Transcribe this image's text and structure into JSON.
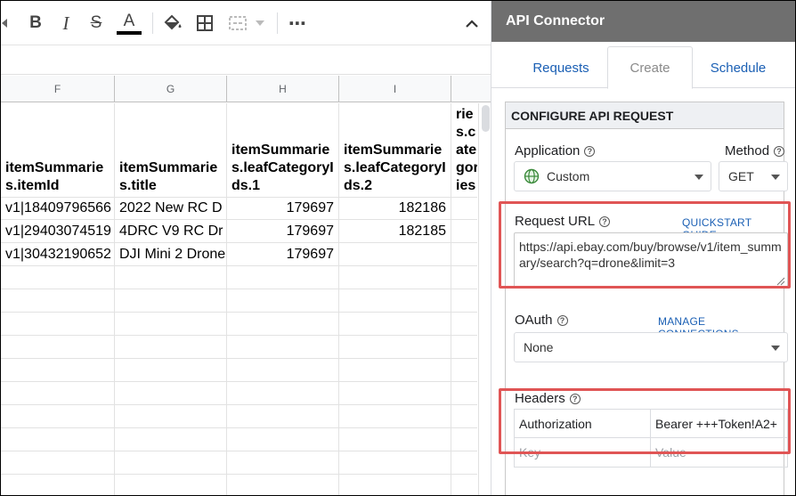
{
  "toolbar": {
    "bold": "B",
    "italic": "I",
    "strike": "S",
    "text_color": "A",
    "more": "⋯"
  },
  "sheet": {
    "columns": [
      "F",
      "G",
      "H",
      "I",
      ""
    ],
    "header_row": [
      "itemSummaries.itemId",
      "itemSummaries.title",
      "itemSummaries.leafCategoryIds.1",
      "itemSummaries.leafCategoryIds.2",
      "itemSummaries.categories"
    ],
    "rows": [
      [
        "v1|18409796566",
        "2022 New RC D",
        "179697",
        "182186",
        ""
      ],
      [
        "v1|29403074519",
        "4DRC V9 RC Dr",
        "179697",
        "182185",
        ""
      ],
      [
        "v1|30432190652",
        "DJI Mini 2 Drone",
        "179697",
        "",
        ""
      ]
    ]
  },
  "panel": {
    "title": "API Connector",
    "tabs": [
      "Requests",
      "Create",
      "Schedule"
    ],
    "active_tab": "Create",
    "section_title": "CONFIGURE API REQUEST",
    "application_label": "Application",
    "application_value": "Custom",
    "method_label": "Method",
    "method_value": "GET",
    "request_url_label": "Request URL",
    "quickstart_link": "QUICKSTART GUIDE",
    "request_url_value": "https://api.ebay.com/buy/browse/v1/item_summary/search?q=drone&limit=3",
    "oauth_label": "OAuth",
    "manage_connections_link": "MANAGE CONNECTIONS",
    "oauth_value": "None",
    "headers_label": "Headers",
    "headers": [
      {
        "key": "Authorization",
        "value": "Bearer +++Token!A2+"
      }
    ],
    "header_key_placeholder": "Key",
    "header_value_placeholder": "Value"
  },
  "colors": {
    "panel_header_bg": "#6f6f6f",
    "link": "#1a5fb4",
    "highlight": "#e05555"
  }
}
